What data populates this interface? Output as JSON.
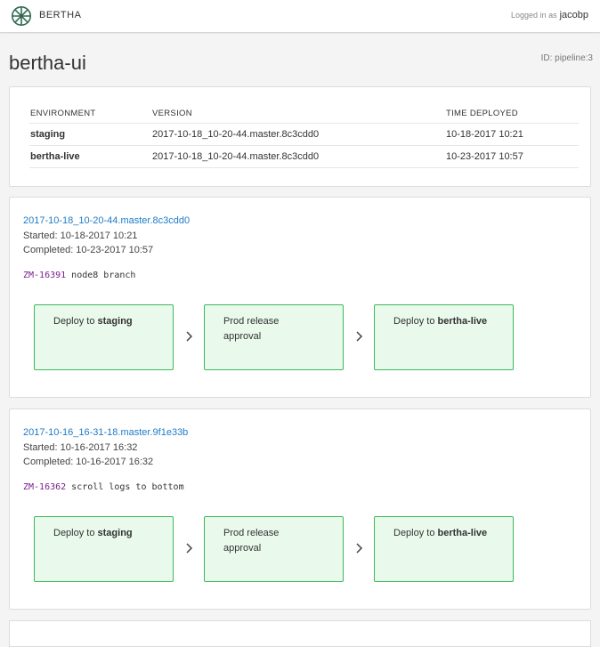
{
  "header": {
    "brand": "BERTHA",
    "logged_in_label": "Logged in as",
    "username": "jacobp"
  },
  "pipeline": {
    "title": "bertha-ui",
    "id_label": "ID: pipeline:3"
  },
  "environments": {
    "columns": [
      "ENVIRONMENT",
      "VERSION",
      "TIME DEPLOYED"
    ],
    "rows": [
      {
        "env": "staging",
        "version": "2017-10-18_10-20-44.master.8c3cdd0",
        "time": "10-18-2017 10:21"
      },
      {
        "env": "bertha-live",
        "version": "2017-10-18_10-20-44.master.8c3cdd0",
        "time": "10-23-2017 10:57"
      }
    ]
  },
  "releases": [
    {
      "version": "2017-10-18_10-20-44.master.8c3cdd0",
      "started": "Started: 10-18-2017 10:21",
      "completed": "Completed: 10-23-2017 10:57",
      "ticket": "ZM-16391",
      "message": "node8 branch",
      "stages": [
        {
          "prefix": "Deploy to ",
          "target": "staging"
        },
        {
          "prefix": "Prod release approval",
          "target": ""
        },
        {
          "prefix": "Deploy to ",
          "target": "bertha-live"
        }
      ]
    },
    {
      "version": "2017-10-16_16-31-18.master.9f1e33b",
      "started": "Started: 10-16-2017 16:32",
      "completed": "Completed: 10-16-2017 16:32",
      "ticket": "ZM-16362",
      "message": "scroll logs to bottom",
      "stages": [
        {
          "prefix": "Deploy to ",
          "target": "staging"
        },
        {
          "prefix": "Prod release approval",
          "target": ""
        },
        {
          "prefix": "Deploy to ",
          "target": "bertha-live"
        }
      ]
    }
  ],
  "colors": {
    "link": "#1e7bc7",
    "ticket": "#7a1f8c",
    "stage_border": "#3cb95a",
    "stage_fill": "#e9f9ec",
    "logo": "#2f6b4f"
  },
  "icons": {
    "logo": "bertha-logo-icon",
    "chevron": "chevron-right-icon"
  }
}
